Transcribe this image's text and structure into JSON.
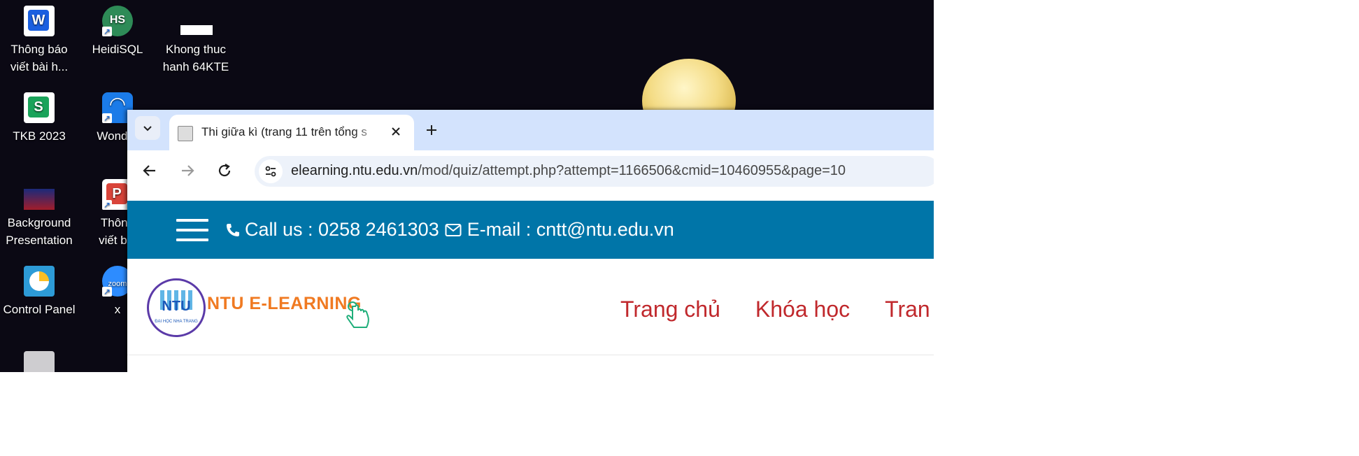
{
  "desktop": {
    "icons": [
      {
        "label": "Thông báo\nviết bài h...",
        "icon": "word-doc-icon"
      },
      {
        "label": "HeidiSQL",
        "icon": "heidisql-icon"
      },
      {
        "label": "Khong thuc\nhanh 64KTE",
        "icon": "file-thumbnail-icon"
      },
      {
        "label": "TKB 2023",
        "icon": "spreadsheet-icon"
      },
      {
        "label": "Wonder",
        "icon": "wondershare-icon"
      },
      {
        "label": "Background\nPresentation",
        "icon": "presentation-thumbnail-icon"
      },
      {
        "label": "Thông\nviết bài",
        "icon": "pdf-doc-icon"
      },
      {
        "label": "Control Panel",
        "icon": "control-panel-icon"
      },
      {
        "label": "x",
        "icon": "zoom-icon"
      },
      {
        "label": "",
        "icon": "recycle-bin-icon"
      }
    ]
  },
  "browser": {
    "tab": {
      "title": "Thi giữa kì (trang 11 trên tổng s",
      "favicon": "page-favicon-icon"
    },
    "url": {
      "host": "elearning.ntu.edu.vn",
      "path": "/mod/quiz/attempt.php?attempt=1166506&cmid=10460955&page=10"
    }
  },
  "page": {
    "topbar": {
      "phone_label": "Call us : 0258 2461303",
      "email_label": "E-mail : cntt@ntu.edu.vn",
      "bg_color": "#0075a8"
    },
    "logo": {
      "emblem_text": "NTU",
      "emblem_subtext": "ĐẠI HỌC NHA TRANG",
      "brand_text": "NTU E-LEARNING"
    },
    "nav": [
      "Trang chủ",
      "Khóa học",
      "Tran"
    ],
    "accent_color": "#c0282c"
  }
}
